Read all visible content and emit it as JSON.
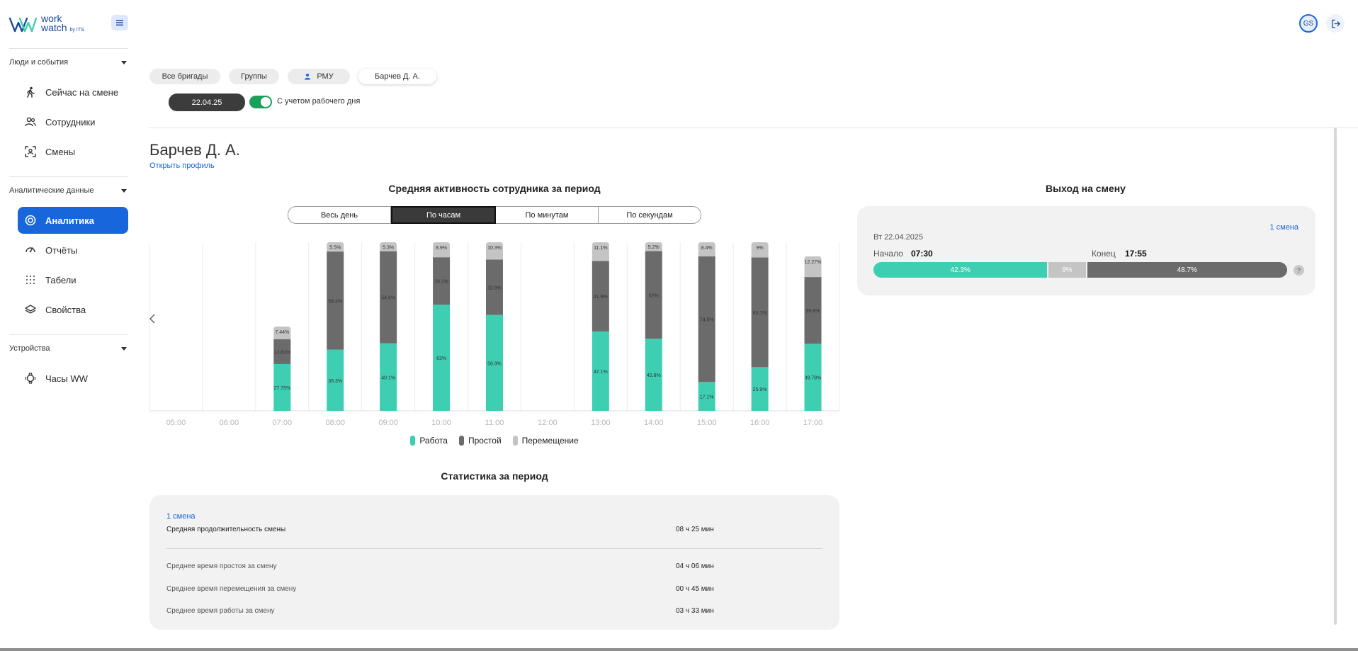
{
  "app": {
    "logo_line1": "work",
    "logo_line2": "watch",
    "logo_by": "by ITS",
    "brand_color": "#1766dc"
  },
  "sidebar": {
    "sections": [
      {
        "title": "Люди и события",
        "items": [
          {
            "label": "Сейчас на смене",
            "icon": "walking-person-icon"
          },
          {
            "label": "Сотрудники",
            "icon": "people-icon"
          },
          {
            "label": "Смены",
            "icon": "scan-person-icon"
          }
        ]
      },
      {
        "title": "Аналитические данные",
        "items": [
          {
            "label": "Аналитика",
            "icon": "target-icon",
            "active": true
          },
          {
            "label": "Отчёты",
            "icon": "gauge-icon"
          },
          {
            "label": "Табели",
            "icon": "grid-icon"
          },
          {
            "label": "Свойства",
            "icon": "layers-icon"
          }
        ]
      },
      {
        "title": "Устройства",
        "items": [
          {
            "label": "Часы WW",
            "icon": "watch-icon"
          }
        ]
      }
    ]
  },
  "user": {
    "initials": "GS"
  },
  "filters": {
    "pills": [
      "Все бригады",
      "Группы",
      "РМУ",
      "Барчев Д. А."
    ],
    "date": "22.04.25",
    "workday_toggle_label": "С учетом рабочего дня",
    "workday_toggle_on": true
  },
  "employee": {
    "name": "Барчев Д. А.",
    "profile_link": "Открыть профиль"
  },
  "activity": {
    "title": "Средняя активность сотрудника за период",
    "modes": [
      "Весь день",
      "По часам",
      "По минутам",
      "По секундам"
    ],
    "active_mode": 1
  },
  "chart_data": {
    "type": "bar",
    "stacked": true,
    "categories": [
      "05:00",
      "06:00",
      "07:00",
      "08:00",
      "09:00",
      "10:00",
      "11:00",
      "12:00",
      "13:00",
      "14:00",
      "15:00",
      "16:00",
      "17:00"
    ],
    "series": [
      {
        "name": "Работа",
        "color": "#3ecfb2",
        "values": [
          0,
          0,
          27.75,
          36.3,
          40.1,
          63,
          56.9,
          0,
          47.1,
          42.8,
          17.1,
          25.9,
          39.78
        ],
        "labels": [
          "",
          "",
          "27.75%",
          "36.3%",
          "40.1%",
          "63%",
          "56.9%",
          "",
          "47.1%",
          "42.8%",
          "17.1%",
          "25.9%",
          "39.78%"
        ]
      },
      {
        "name": "Простой",
        "color": "#6b6b6b",
        "values": [
          0,
          0,
          14.81,
          58.2,
          54.6,
          28.1,
          32.8,
          0,
          41.8,
          52,
          74.5,
          65.1,
          39.6
        ],
        "labels": [
          "",
          "",
          "14.81%",
          "58.2%",
          "54.6%",
          "28.1%",
          "32.8%",
          "",
          "41.8%",
          "52%",
          "74.5%",
          "65.1%",
          "39.6%"
        ]
      },
      {
        "name": "Перемещение",
        "color": "#c4c4c4",
        "values": [
          0,
          0,
          7.44,
          5.5,
          5.3,
          8.9,
          10.3,
          0,
          11.1,
          5.2,
          8.4,
          9,
          12.27
        ],
        "labels": [
          "",
          "",
          "7.44%",
          "5.5%",
          "5.3%",
          "8.9%",
          "10.3%",
          "",
          "11.1%",
          "5.2%",
          "8.4%",
          "9%",
          "12.27%"
        ]
      }
    ],
    "ylim": [
      0,
      100
    ],
    "grid": true,
    "legend": "bottom-center"
  },
  "stats": {
    "title": "Статистика за период",
    "shift_label": "1 смена",
    "rows": [
      {
        "label": "Средняя продолжительность смены",
        "value": "08 ч 25 мин"
      },
      {
        "label": "Среднее время простоя за смену",
        "value": "04 ч 06 мин"
      },
      {
        "label": "Среднее время перемещения за смену",
        "value": "00 ч 45 мин"
      },
      {
        "label": "Среднее время работы за смену",
        "value": "03 ч 33 мин"
      }
    ]
  },
  "shift": {
    "title": "Выход на смену",
    "shift_label": "1 смена",
    "date": "Вт 22.04.2025",
    "start_label": "Начало",
    "start_value": "07:30",
    "end_label": "Конец",
    "end_value": "17:55",
    "bar": [
      {
        "label": "42.3%",
        "value": 42.3,
        "color": "#3ecfb2"
      },
      {
        "label": "9%",
        "value": 9,
        "color": "#c4c4c4"
      },
      {
        "label": "48.7%",
        "value": 48.7,
        "color": "#6b6b6b"
      }
    ],
    "help": "?"
  }
}
